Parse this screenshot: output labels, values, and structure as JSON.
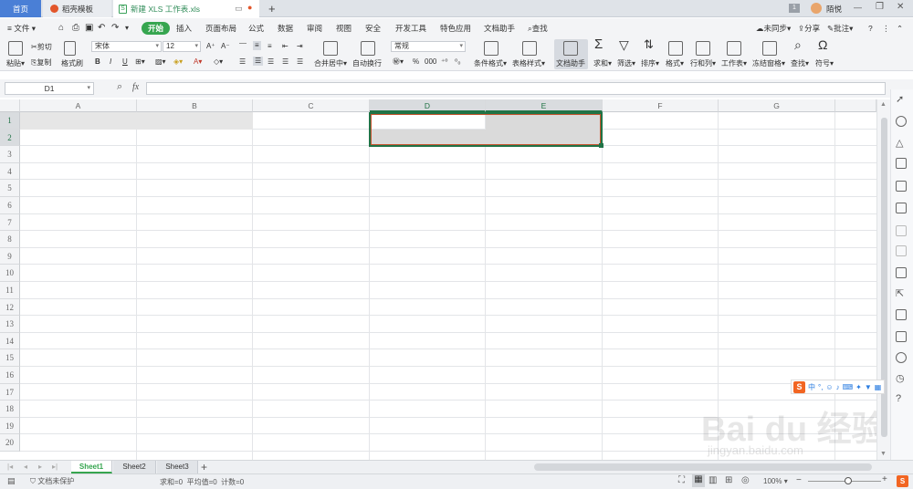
{
  "tabs": {
    "home": "首页",
    "doc": "稻壳模板",
    "file": "新建 XLS 工作表.xls",
    "user": "陌悦"
  },
  "menu": {
    "file": "文件",
    "items": [
      "开始",
      "插入",
      "页面布局",
      "公式",
      "数据",
      "审阅",
      "视图",
      "安全",
      "开发工具",
      "特色应用",
      "文档助手"
    ],
    "search": "查找",
    "sync": "未同步",
    "share": "分享",
    "comment": "批注"
  },
  "ribbon": {
    "paste": "粘贴",
    "cut": "剪切",
    "copy": "复制",
    "format_painter": "格式刷",
    "font_name": "宋体",
    "font_size": "12",
    "merge": "合并居中",
    "wrap": "自动换行",
    "number_format": "常规",
    "cond_format": "条件格式",
    "table_style": "表格样式",
    "doc_helper": "文档助手",
    "sum": "求和",
    "filter": "筛选",
    "sort": "排序",
    "format": "格式",
    "rowcol": "行和列",
    "sheet": "工作表",
    "freeze": "冻结窗格",
    "find": "查找",
    "symbol": "符号"
  },
  "formula": {
    "name_box": "D1",
    "fx": "fx",
    "value": ""
  },
  "grid": {
    "columns": [
      "A",
      "B",
      "C",
      "D",
      "E",
      "F",
      "G"
    ],
    "rows": [
      "1",
      "2",
      "3",
      "4",
      "5",
      "6",
      "7",
      "8",
      "9",
      "10",
      "11",
      "12",
      "13",
      "14",
      "15",
      "16",
      "17",
      "18",
      "19",
      "20"
    ]
  },
  "sheets": [
    "Sheet1",
    "Sheet2",
    "Sheet3"
  ],
  "status": {
    "protect": "文档未保护",
    "stats": "求和=0  平均值=0  计数=0",
    "zoom": "100%"
  },
  "colors": {
    "accent": "#36a54f",
    "selection": "#217346",
    "home_tab": "#4a7fd6"
  },
  "watermark": {
    "brand": "Bai du 经验",
    "url": "jingyan.baidu.com"
  }
}
